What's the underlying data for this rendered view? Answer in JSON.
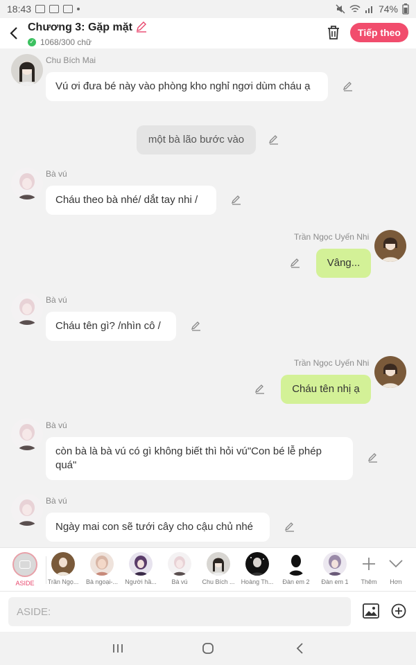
{
  "status_bar": {
    "time": "18:43",
    "battery": "74%"
  },
  "header": {
    "title": "Chương 3: Gặp mặt",
    "word_count": "1068/300 chữ",
    "next_label": "Tiếp theo"
  },
  "messages": [
    {
      "sender": "Chu Bích Mai",
      "text": "Vú ơi đưa bé này vào phòng kho nghỉ ngơi dùm cháu ạ"
    },
    {
      "text": "một bà lão bước vào"
    },
    {
      "sender": "Bà vú",
      "text": "Cháu theo bà nhé/ dắt tay nhi /"
    },
    {
      "sender": "Trần Ngọc Uyến Nhi",
      "text": "Vâng..."
    },
    {
      "sender": "Bà vú",
      "text": "Cháu tên gì? /nhìn cô /"
    },
    {
      "sender": "Trần Ngọc Uyến Nhi",
      "text": "Cháu tên nhị ạ"
    },
    {
      "sender": "Bà vú",
      "text": "còn bà là bà vú có gì không biết thì hỏi vú\"Con bé lễ phép quá\""
    },
    {
      "sender": "Bà vú",
      "text": "Ngày mai con sẽ tưới cây cho cậu chủ nhé"
    }
  ],
  "characters": {
    "aside": "ASIDE",
    "items": [
      "Trần Ngọ...",
      "Bà ngoại-...",
      "Người hầ...",
      "Bà vú",
      "Chu Bích ...",
      "Hoàng Th...",
      "Đàn em 2",
      "Đàn em 1"
    ],
    "more": "Thêm",
    "expand": "Hơn"
  },
  "input": {
    "placeholder": "ASIDE:"
  },
  "colors": {
    "accent": "#f14d6d",
    "my_bubble": "#d3f197"
  }
}
